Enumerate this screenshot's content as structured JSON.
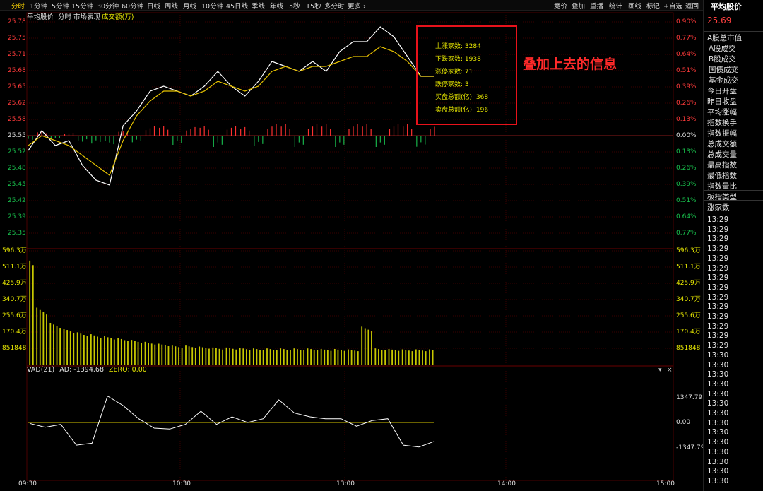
{
  "toolbar": {
    "periods": [
      "分时",
      "1分钟",
      "5分钟",
      "15分钟",
      "30分钟",
      "60分钟",
      "日线",
      "周线",
      "月线",
      "10分钟",
      "45日线",
      "季线",
      "年线",
      "5秒",
      "15秒",
      "多分时",
      "更多 ›"
    ],
    "active_period": "分时",
    "right_tools": [
      "竞价",
      "叠加",
      "重播",
      "统计",
      "画线",
      "标记",
      "+自选",
      "返回"
    ]
  },
  "subheader": {
    "index_name": "平均股价",
    "mode": "分时",
    "market_view": "市场表现",
    "volume_label": "成交额(万)"
  },
  "price_axis": {
    "left": [
      "25.78",
      "25.75",
      "25.71",
      "25.68",
      "25.65",
      "25.62",
      "25.58",
      "25.55",
      "25.52",
      "25.48",
      "25.45",
      "25.42",
      "25.39",
      "25.35"
    ],
    "right": [
      "0.90%",
      "0.77%",
      "0.64%",
      "0.51%",
      "0.39%",
      "0.26%",
      "0.13%",
      "0.00%",
      "0.13%",
      "0.26%",
      "0.39%",
      "0.51%",
      "0.64%",
      "0.77%"
    ],
    "base_index": 7
  },
  "volume_axis": {
    "left": [
      "596.3万",
      "511.1万",
      "425.9万",
      "340.7万",
      "255.6万",
      "170.4万",
      "851848"
    ],
    "right": [
      "596.3万",
      "511.1万",
      "425.9万",
      "340.7万",
      "255.6万",
      "170.4万",
      "851848"
    ]
  },
  "vad": {
    "name": "VAD(21)",
    "ad_label": "AD: -1394.68",
    "zero_label": "ZERO: 0.00",
    "axis": [
      "1347.79",
      "0.00",
      "-1347.79"
    ]
  },
  "time_axis": [
    "09:30",
    "10:30",
    "13:00",
    "14:00",
    "15:00"
  ],
  "overlay": {
    "rows": [
      "上涨家数: 3284",
      "下跌家数: 1938",
      "涨停家数: 71",
      "跌停家数: 3",
      "买盘总额(亿): 368",
      "卖盘总额(亿): 196"
    ],
    "caption": "叠加上去的信息"
  },
  "right_panel": {
    "title": "平均股价",
    "value": "25.69",
    "items": [
      "A股总市值",
      "A股成交",
      "B股成交",
      "国债成交",
      "基金成交",
      "今日开盘",
      "昨日收盘",
      "平均涨幅",
      "指数换手",
      "指数振幅",
      "总成交额",
      "总成交量",
      "最高指数",
      "最低指数",
      "指数量比",
      "板指类型",
      "涨家数"
    ],
    "times": [
      "13:29",
      "13:29",
      "13:29",
      "13:29",
      "13:29",
      "13:29",
      "13:29",
      "13:29",
      "13:29",
      "13:29",
      "13:29",
      "13:29",
      "13:29",
      "13:29",
      "13:30",
      "13:30",
      "13:30",
      "13:30",
      "13:30",
      "13:30",
      "13:30",
      "13:30",
      "13:30",
      "13:30",
      "13:30",
      "13:30",
      "13:30",
      "13:30"
    ]
  },
  "chart_data": {
    "type": "line",
    "time": [
      "09:30",
      "09:35",
      "09:40",
      "09:45",
      "09:50",
      "09:55",
      "10:00",
      "10:05",
      "10:10",
      "10:15",
      "10:20",
      "10:25",
      "10:30",
      "10:35",
      "10:40",
      "10:45",
      "10:50",
      "10:55",
      "11:00",
      "11:05",
      "11:10",
      "11:15",
      "11:20",
      "11:25",
      "11:30",
      "13:05",
      "13:10",
      "13:15",
      "13:20",
      "13:25",
      "13:30"
    ],
    "series": [
      {
        "values": [
          25.53,
          25.57,
          25.54,
          25.55,
          25.5,
          25.47,
          25.46,
          25.58,
          25.61,
          25.65,
          25.66,
          25.65,
          25.64,
          25.66,
          25.69,
          25.66,
          25.64,
          25.67,
          25.71,
          25.7,
          25.69,
          25.71,
          25.69,
          25.73,
          25.75,
          25.75,
          25.78,
          25.76,
          25.72,
          25.68,
          25.68
        ],
        "color": "#ffffff"
      },
      {
        "values": [
          25.54,
          25.56,
          25.55,
          25.54,
          25.52,
          25.5,
          25.48,
          25.55,
          25.6,
          25.63,
          25.65,
          25.65,
          25.64,
          25.65,
          25.67,
          25.66,
          25.65,
          25.66,
          25.69,
          25.7,
          25.69,
          25.7,
          25.7,
          25.71,
          25.72,
          25.72,
          25.74,
          25.73,
          25.71,
          25.68,
          25.68
        ],
        "color": "#e6c200"
      }
    ],
    "volume": [
      596,
      300,
      220,
      190,
      170,
      160,
      150,
      140,
      130,
      120,
      110,
      100,
      100,
      95,
      90,
      90,
      88,
      85,
      85,
      85,
      85,
      85,
      82,
      82,
      80,
      200,
      85,
      82,
      80,
      80,
      80
    ],
    "vad": [
      -50,
      -250,
      -100,
      -1200,
      -1100,
      1400,
      900,
      200,
      -300,
      -350,
      -100,
      600,
      -100,
      300,
      0,
      200,
      1200,
      500,
      300,
      200,
      200,
      -200,
      100,
      200,
      -1200,
      -1300,
      -1000
    ],
    "ylim": [
      25.33,
      25.79
    ],
    "base": 25.55
  }
}
